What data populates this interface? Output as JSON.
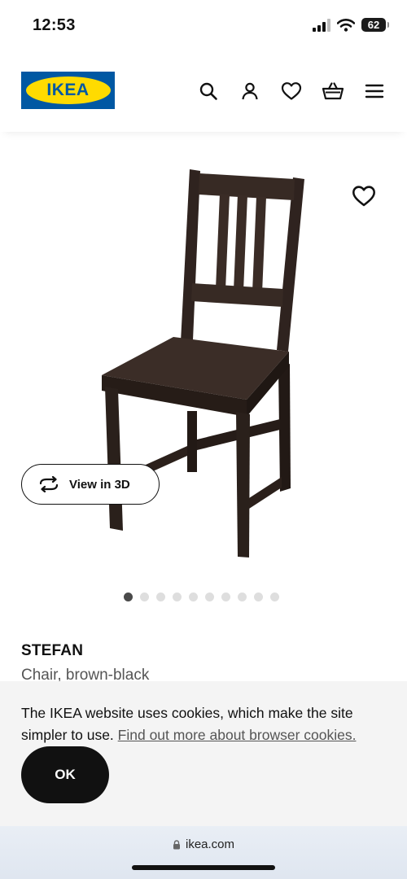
{
  "status_bar": {
    "time": "12:53",
    "battery": "62"
  },
  "header": {
    "logo_text": "IKEA",
    "icons": [
      "search-icon",
      "account-icon",
      "heart-icon",
      "basket-icon",
      "menu-icon"
    ]
  },
  "gallery": {
    "view_3d_label": "View in 3D",
    "dot_count": 10,
    "active_dot": 1
  },
  "product": {
    "name": "STEFAN",
    "description": "Chair, brown-black"
  },
  "cookie_banner": {
    "text": "The IKEA website uses cookies, which make the site simpler to use.",
    "link_text": "Find out more about browser cookies.",
    "ok_label": "OK"
  },
  "browser": {
    "url": "ikea.com"
  },
  "colors": {
    "ikea_blue": "#0058a3",
    "ikea_yellow": "#ffdb00",
    "chair": "#2f231f",
    "cookie_bg": "#f4f4f4"
  }
}
